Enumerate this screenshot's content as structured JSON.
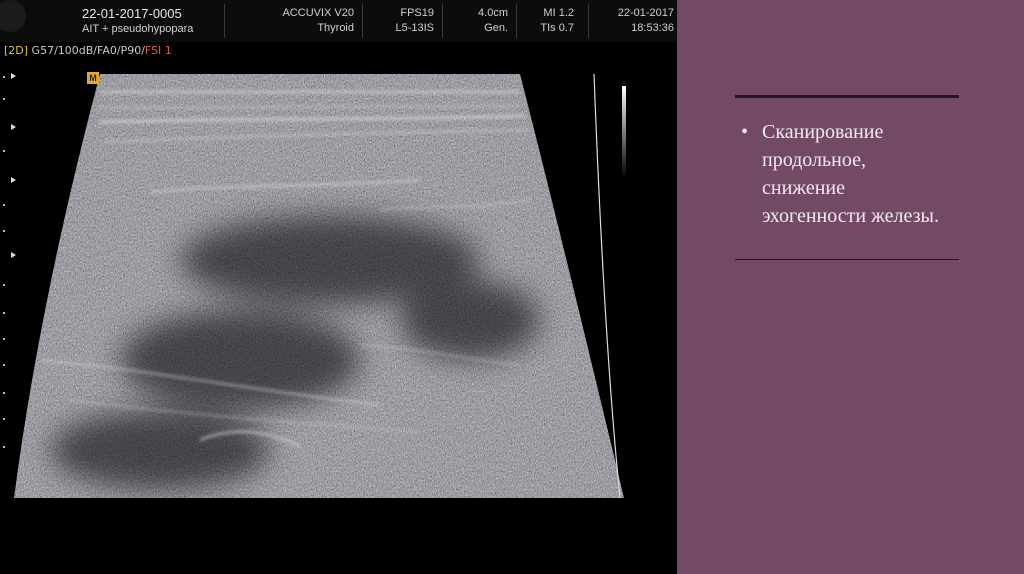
{
  "ultrasound": {
    "header": {
      "date_id": "22-01-2017-0005",
      "patient": "AIT + pseudohypopara",
      "device": "ACCUVIX V20",
      "preset": "Thyroid",
      "fps": "FPS19",
      "probe": "L5-13IS",
      "depth": "4.0cm",
      "gen": "Gen.",
      "mi": "MI 1.2",
      "tis": "TIs 0.7",
      "date": "22-01-2017",
      "time": "18:53:36"
    },
    "params": {
      "mode": "[2D]",
      "settings": " G57/100dB/FA0/P90/",
      "fsi": "FSI 1"
    },
    "marker": "M"
  },
  "slide": {
    "bullet": "•",
    "text": "Сканирование продольное, снижение эхогенности железы."
  },
  "colors": {
    "panel_background": "#734a66",
    "text": "#f2e9ee",
    "rule": "#1e1a1d"
  }
}
